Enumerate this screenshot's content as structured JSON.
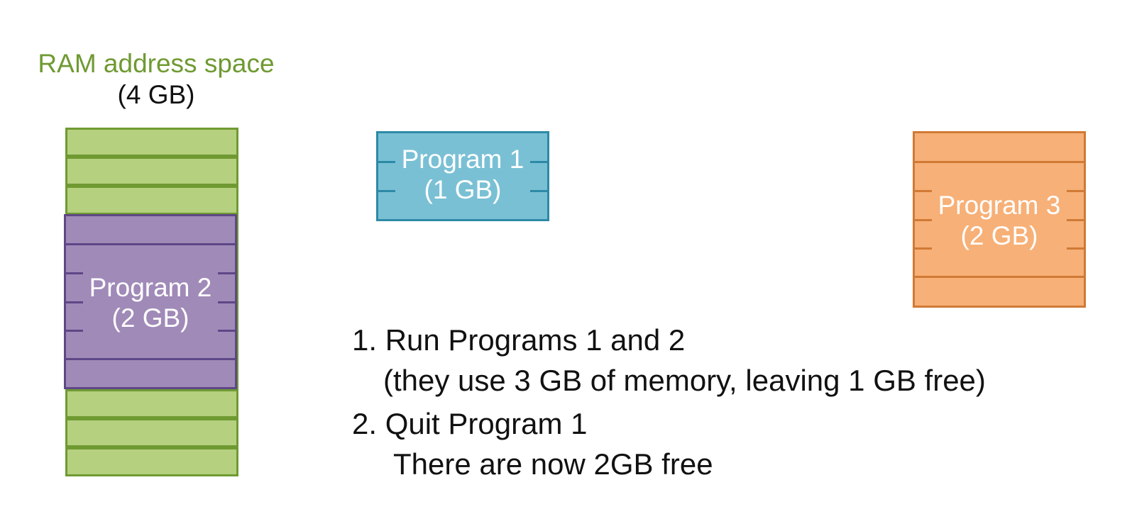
{
  "ram": {
    "title": "RAM address space",
    "size": "(4 GB)"
  },
  "programs": {
    "program1": {
      "name": "Program 1",
      "size": "(1 GB)"
    },
    "program2": {
      "name": "Program 2",
      "size": "(2 GB)"
    },
    "program3": {
      "name": "Program 3",
      "size": "(2 GB)"
    }
  },
  "steps": {
    "step1": "1. Run Programs 1 and 2",
    "step1_detail": "(they use 3 GB of memory, leaving 1 GB free)",
    "step2": "2. Quit Program 1",
    "step2_detail": "There are now 2GB free"
  },
  "colors": {
    "ram_fill": "#b5d07f",
    "ram_border": "#6f9a32",
    "program1_fill": "#7ac0d5",
    "program2_fill": "#a08ab8",
    "program3_fill": "#f7b077"
  }
}
